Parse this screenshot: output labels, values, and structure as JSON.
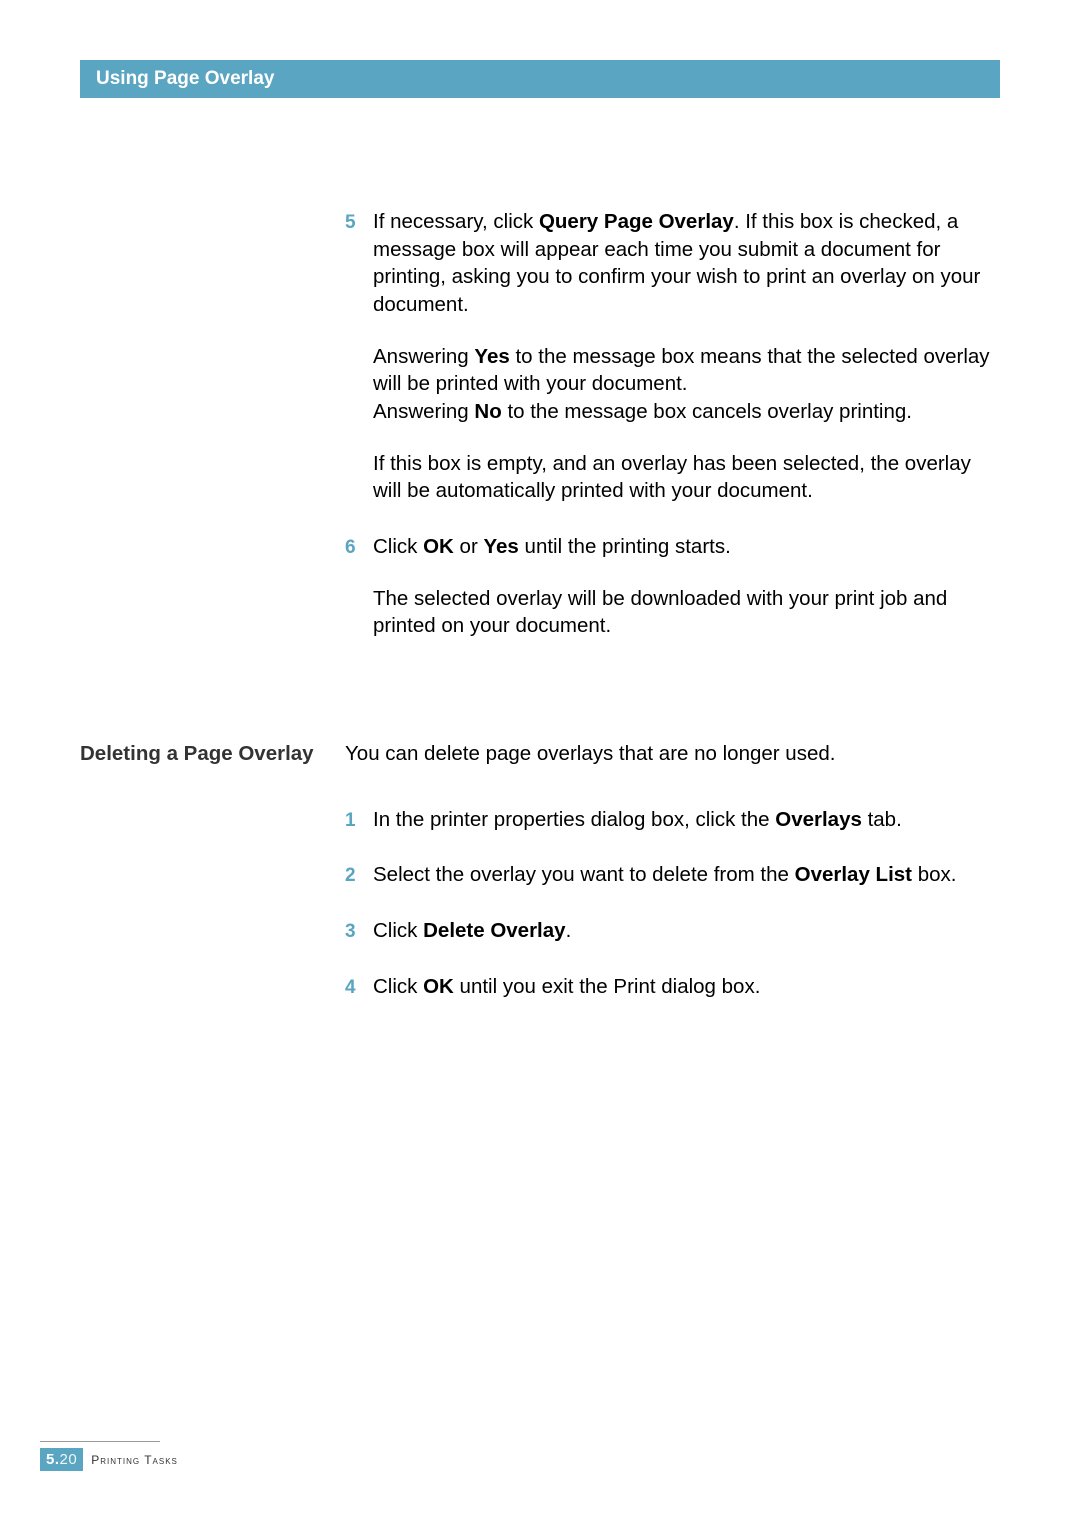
{
  "header": {
    "title": "Using Page Overlay"
  },
  "section1": {
    "steps": [
      {
        "num": "5",
        "paras": [
          "If necessary, click <b>Query Page Overlay</b>. If this box is checked, a message box will appear each time you submit a document for printing, asking you to confirm your wish to print an overlay on your document.",
          "Answering <b>Yes</b> to the message box means that the selected overlay will be printed with your document.<br>Answering <b>No</b> to the message box cancels overlay printing.",
          "If this box is empty, and an overlay has been selected, the overlay will be automatically printed with your document."
        ]
      },
      {
        "num": "6",
        "paras": [
          "Click <b>OK</b> or <b>Yes</b> until the printing starts.",
          "The selected overlay will be downloaded with your print job and printed on your document."
        ]
      }
    ]
  },
  "section2": {
    "heading": "Deleting a Page Overlay",
    "intro": "You can delete page overlays that are no longer used.",
    "steps": [
      {
        "num": "1",
        "paras": [
          "In the printer properties dialog box, click the <b>Overlays</b> tab."
        ]
      },
      {
        "num": "2",
        "paras": [
          "Select the overlay you want to delete from the <b>Overlay List</b> box."
        ]
      },
      {
        "num": "3",
        "paras": [
          "Click <b>Delete Overlay</b>."
        ]
      },
      {
        "num": "4",
        "paras": [
          "Click <b>OK</b> until you exit the Print dialog box."
        ]
      }
    ]
  },
  "footer": {
    "chapter": "5.",
    "page": "20",
    "label": "Printing Tasks"
  }
}
